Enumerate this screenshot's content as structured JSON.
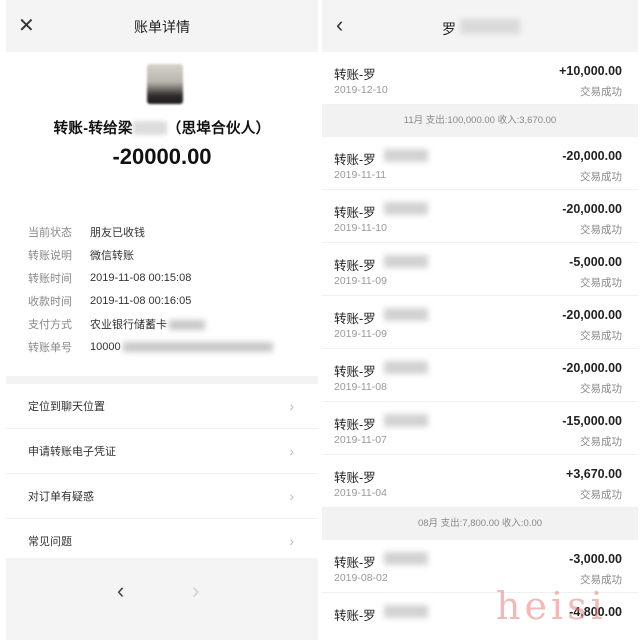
{
  "left_panel": {
    "header": {
      "close_icon": "close-icon",
      "title": "账单详情"
    },
    "payee": {
      "label_prefix": "转账-转给梁",
      "label_suffix": "（思埠合伙人）"
    },
    "amount": "-20000.00",
    "details": [
      {
        "key": "当前状态",
        "value": "朋友已收钱"
      },
      {
        "key": "转账说明",
        "value": "微信转账"
      },
      {
        "key": "转账时间",
        "value": "2019-11-08 00:15:08"
      },
      {
        "key": "收款时间",
        "value": "2019-11-08 00:16:05"
      },
      {
        "key": "支付方式",
        "value": "农业银行储蓄卡"
      },
      {
        "key": "转账单号",
        "value": "10000"
      }
    ],
    "menu": [
      {
        "label": "定位到聊天位置"
      },
      {
        "label": "申请转账电子凭证"
      },
      {
        "label": "对订单有疑惑"
      },
      {
        "label": "常见问题"
      }
    ],
    "footer": {
      "back_icon": "chevron-left-icon",
      "forward_icon": "chevron-right-icon"
    }
  },
  "right_panel": {
    "header": {
      "back_icon": "chevron-left-icon",
      "name": "罗"
    },
    "top_txn": {
      "title": "转账-罗",
      "date": "2019-12-10",
      "amount": "+10,000.00",
      "status": "交易成功"
    },
    "month_nov": "11月  支出:100,000.00  收入:3,670.00",
    "nov_txns": [
      {
        "title": "转账-罗",
        "date": "2019-11-11",
        "amount": "-20,000.00",
        "status": "交易成功"
      },
      {
        "title": "转账-罗",
        "date": "2019-11-10",
        "amount": "-20,000.00",
        "status": "交易成功"
      },
      {
        "title": "转账-罗",
        "date": "2019-11-09",
        "amount": "-5,000.00",
        "status": "交易成功"
      },
      {
        "title": "转账-罗",
        "date": "2019-11-09",
        "amount": "-20,000.00",
        "status": "交易成功"
      },
      {
        "title": "转账-罗",
        "date": "2019-11-08",
        "amount": "-20,000.00",
        "status": "交易成功"
      },
      {
        "title": "转账-罗",
        "date": "2019-11-07",
        "amount": "-15,000.00",
        "status": "交易成功"
      },
      {
        "title": "转账-罗",
        "date": "2019-11-04",
        "amount": "+3,670.00",
        "status": "交易成功"
      }
    ],
    "month_aug": "08月  支出:7,800.00  收入:0.00",
    "aug_txns": [
      {
        "title": "转账-罗",
        "date": "2019-08-02",
        "amount": "-3,000.00",
        "status": "交易成功"
      },
      {
        "title": "转账-罗",
        "date": "",
        "amount": "-4,800.00",
        "status": ""
      }
    ]
  },
  "watermark": "heisi"
}
